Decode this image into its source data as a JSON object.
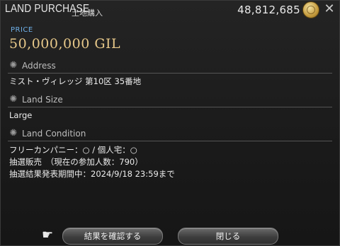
{
  "header": {
    "title": "LAND PURCHASE",
    "subtitle": "土地購入",
    "gil_balance": "48,812,685",
    "coin_icon": "gil-coin-icon",
    "close_icon": "close-icon"
  },
  "price": {
    "label": "PRICE",
    "value": "50,000,000 GIL"
  },
  "sections": {
    "address": {
      "label": "Address",
      "value": "ミスト・ヴィレッジ 第10区 35番地"
    },
    "land_size": {
      "label": "Land Size",
      "value": "Large"
    },
    "land_condition": {
      "label": "Land Condition",
      "lines": [
        "フリーカンパニー：○ / 個人宅：○",
        "抽選販売　（現在の参加人数：790）",
        "抽選結果発表期間中：2024/9/18 23:59まで"
      ]
    }
  },
  "footer": {
    "confirm_label": "結果を確認する",
    "close_label": "閉じる"
  },
  "colors": {
    "accent_price_label": "#6fb0e8",
    "price_value": "#e8c98a",
    "background": "#1c1c1c"
  }
}
